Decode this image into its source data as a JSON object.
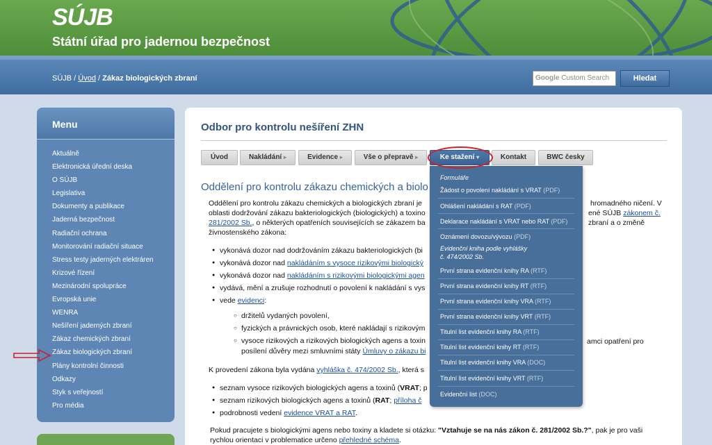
{
  "header": {
    "logo": "SÚJB",
    "office_name": "Státní úřad pro jadernou bezpečnost"
  },
  "breadcrumb": {
    "root": "SÚJB",
    "sep": " / ",
    "home": "Úvod",
    "current": "Zákaz biologických zbraní"
  },
  "search": {
    "google": "Google",
    "placeholder": "Custom Search",
    "button": "Hledat"
  },
  "menu": {
    "title": "Menu",
    "items": [
      "Aktuálně",
      "Elektronická úřední deska",
      "O SÚJB",
      "Legislativa",
      "Dokumenty a publikace",
      "Jaderná bezpečnost",
      "Radiační ochrana",
      "Monitorování radiační situace",
      "Stress testy jaderných elektráren",
      "Krizové řízení",
      "Mezinárodní spolupráce",
      "Evropská unie",
      "WENRA",
      "Nešíření jaderných zbraní",
      "Zákaz chemických zbraní",
      "Zákaz biologických zbraní",
      "Plány kontrolní činnosti",
      "Odkazy",
      "Styk s veřejností",
      "Pro média"
    ]
  },
  "content": {
    "section_title": "Odbor pro kontrolu nešíření ZHN",
    "tabs": [
      "Úvod",
      "Nakládání",
      "Evidence",
      "Vše o přepravě",
      "Ke stažení",
      "Kontakt",
      "BWC česky"
    ],
    "subtitle": "Oddělení pro kontrolu zákazu chemických a biolo",
    "p1_line1": "Oddělení pro kontrolu zákazu chemických a biologických zbraní je",
    "p1_line1_tail": "hromadného ničení. V",
    "p1_line2": "oblasti dodržování zákazu bakteriologických (biologických) a toxino",
    "p1_line2_tail": "ené SÚJB",
    "p1_link1": "zákonem č.",
    "p1_link2": "281/2002 Sb.",
    "p1_line3": ", o některých opatřeních souvisejících se zákazem ba",
    "p1_line3_tail": "zbraní a o změně",
    "p1_line4": "živnostenského zákona:",
    "b1": "vykonává dozor nad dodržováním zákazu bakteriologických (bi",
    "b2_pre": "vykonává dozor nad ",
    "b2_link": "nakládáním s vysoce rizikovými biologický",
    "b3_pre": "vykonává dozor nad ",
    "b3_link": "nakládáním s rizikovými biologickými agen",
    "b4": "vydává, mění a zrušuje rozhodnutí o povolení k nakládání s vys",
    "b5_pre": "vede ",
    "b5_link": "evidenci",
    "b5_post": ":",
    "c1": "držitelů vydaných povolení,",
    "c2": "fyzických a právnických osob, které nakládají s rizikovým",
    "c3_line1": "vysoce rizikových a rizikových biologických agens a toxin",
    "c3_tail": "amci opatření pro",
    "c3_line2": "posílení důvěry mezi smluvními státy",
    "c3_link": "Úmluvy o zákazu bi",
    "p2_pre": "K provedení zákona byla vydána ",
    "p2_link": "vyhláška č. 474/2002 Sb.",
    "p2_post": ", která s",
    "d1_pre": "seznam vysoce rizikových biologických agens a toxinů (",
    "d1_bold": "VRAT",
    "d1_post": "; p",
    "d2_pre": "seznam rizikových biologických agens a toxinů (",
    "d2_bold": "RAT",
    "d2_post": "; ",
    "d2_link": "příloha č",
    "d3_pre": "podrobnosti vedení ",
    "d3_link": "evidence VRAT a RAT",
    "d3_post": ".",
    "p3_pre": "Pokud pracujete s biologickými agens nebo toxiny a kladete si otázku: ",
    "p3_bold": "\"Vztahuje se na nás zákon č. 281/2002 Sb.?\"",
    "p3_post": ", pak je pro vaši",
    "p3_line2": "rychlou orientaci v problematice určeno ",
    "p3_link": "přehledné schéma",
    "p3_end": "."
  },
  "dropdown": {
    "head1": "Formuláře",
    "items_a": [
      {
        "label": "Žádost o povolení nakládání s VRAT",
        "type": "(PDF)"
      },
      {
        "label": "Ohlášení nakládání s RAT",
        "type": "(PDF)"
      },
      {
        "label": "Deklarace nakládání s VRAT nebo RAT",
        "type": "(PDF)"
      },
      {
        "label": "Oznámení dovozu/vývozu",
        "type": "(PDF)"
      }
    ],
    "head2_l1": "Evidenční kniha podle vyhlášky",
    "head2_l2": "č. 474/2002 Sb.",
    "items_b": [
      {
        "label": "První strana evidenční knihy RA",
        "type": "(RTF)"
      },
      {
        "label": "První strana evidenční knihy RT",
        "type": "(RTF)"
      },
      {
        "label": "První strana evidenční knihy VRA",
        "type": "(RTF)"
      },
      {
        "label": "První strana evidenční knihy VRT",
        "type": "(RTF)"
      },
      {
        "label": "Titulní list evidenční knihy RA",
        "type": "(RTF)"
      },
      {
        "label": "Titulní list evidenční knihy RT",
        "type": "(RTF)"
      },
      {
        "label": "Titulní list evidenční knihy VRA",
        "type": "(DOC)"
      },
      {
        "label": "Titulní list evidenční knihy VRT",
        "type": "(RTF)"
      },
      {
        "label": "Evidenční list",
        "type": "(DOC)"
      }
    ]
  },
  "colors": {
    "banner_green": "#5a9a43",
    "nav_blue": "#4a78aa",
    "menu_blue": "#5d86b4",
    "highlight_red": "#d0202a"
  }
}
